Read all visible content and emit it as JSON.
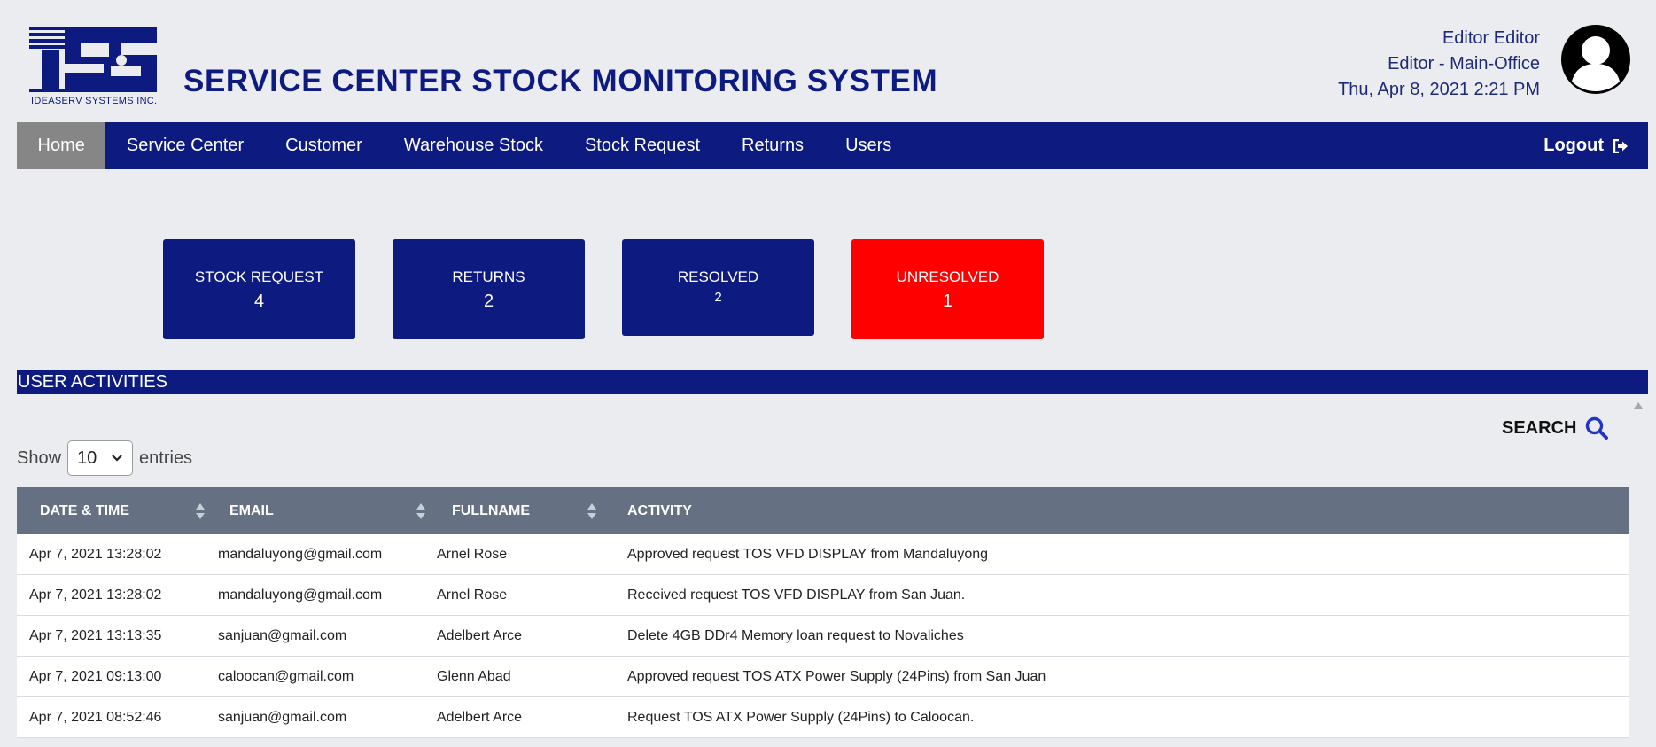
{
  "header": {
    "logo_text": "IDEASERV SYSTEMS INC.",
    "title": "SERVICE CENTER STOCK MONITORING SYSTEM",
    "user_name": "Editor Editor",
    "user_role": "Editor - Main-Office",
    "datetime": "Thu, Apr 8, 2021 2:21 PM"
  },
  "nav": {
    "items": [
      {
        "label": "Home",
        "active": true
      },
      {
        "label": "Service Center"
      },
      {
        "label": "Customer"
      },
      {
        "label": "Warehouse Stock"
      },
      {
        "label": "Stock Request"
      },
      {
        "label": "Returns"
      },
      {
        "label": "Users"
      }
    ],
    "logout_label": "Logout"
  },
  "cards": [
    {
      "label": "STOCK REQUEST",
      "value": "4"
    },
    {
      "label": "RETURNS",
      "value": "2"
    },
    {
      "label": "RESOLVED",
      "value": "2"
    },
    {
      "label": "UNRESOLVED",
      "value": "1",
      "color": "#ff0000"
    }
  ],
  "activities": {
    "title": "USER ACTIVITIES",
    "search_label": "SEARCH",
    "show_label": "Show",
    "entries_value": "10",
    "entries_label": "entries",
    "columns": [
      "DATE & TIME",
      "EMAIL",
      "FULLNAME",
      "ACTIVITY"
    ],
    "rows": [
      [
        "Apr 7, 2021 13:28:02",
        "mandaluyong@gmail.com",
        "Arnel Rose",
        "Approved request TOS VFD DISPLAY from Mandaluyong"
      ],
      [
        "Apr 7, 2021 13:28:02",
        "mandaluyong@gmail.com",
        "Arnel Rose",
        "Received request TOS VFD DISPLAY from San Juan."
      ],
      [
        "Apr 7, 2021 13:13:35",
        "sanjuan@gmail.com",
        "Adelbert Arce",
        "Delete 4GB DDr4 Memory loan request to Novaliches"
      ],
      [
        "Apr 7, 2021 09:13:00",
        "caloocan@gmail.com",
        "Glenn Abad",
        "Approved request TOS ATX Power Supply (24Pins) from San Juan"
      ],
      [
        "Apr 7, 2021 08:52:46",
        "sanjuan@gmail.com",
        "Adelbert Arce",
        "Request TOS ATX Power Supply (24Pins) to Caloocan."
      ]
    ]
  },
  "colors": {
    "brand_navy": "#0d1a80",
    "active_nav": "#868686",
    "alert_red": "#ff0000",
    "table_header": "#657083",
    "page_bg": "#ebecf0"
  },
  "icons": {
    "logo": "ideaserv-logo",
    "avatar": "user-avatar-icon",
    "logout": "sign-out-icon",
    "search": "search-icon",
    "sort": "sort-icon",
    "select": "chevron-down-icon"
  }
}
